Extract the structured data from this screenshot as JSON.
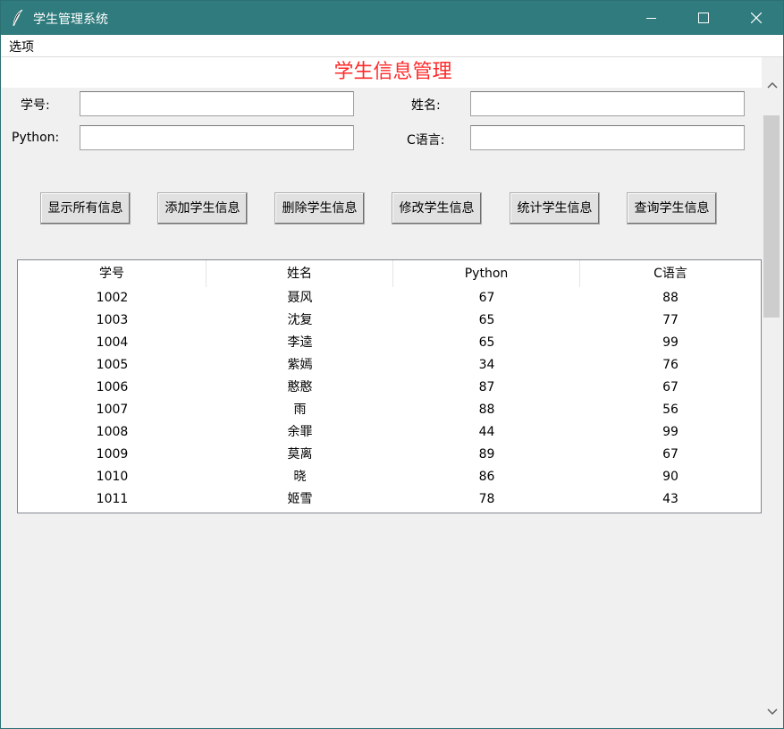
{
  "window": {
    "title": "学生管理系统"
  },
  "menubar": {
    "options_label": "选项"
  },
  "header": {
    "title": "学生信息管理"
  },
  "form": {
    "student_id_label": "学号:",
    "student_id_value": "",
    "name_label": "姓名:",
    "name_value": "",
    "python_label": "Python:",
    "python_value": "",
    "c_label": "C语言:",
    "c_value": ""
  },
  "buttons": {
    "show_all": "显示所有信息",
    "add": "添加学生信息",
    "delete": "删除学生信息",
    "modify": "修改学生信息",
    "stats": "统计学生信息",
    "query": "查询学生信息"
  },
  "table": {
    "columns": [
      "学号",
      "姓名",
      "Python",
      "C语言"
    ],
    "rows": [
      [
        "1002",
        "聂风",
        "67",
        "88"
      ],
      [
        "1003",
        "沈复",
        "65",
        "77"
      ],
      [
        "1004",
        "李逵",
        "65",
        "99"
      ],
      [
        "1005",
        "紫嫣",
        "34",
        "76"
      ],
      [
        "1006",
        "憨憨",
        "87",
        "67"
      ],
      [
        "1007",
        "雨",
        "88",
        "56"
      ],
      [
        "1008",
        "余罪",
        "44",
        "99"
      ],
      [
        "1009",
        "莫离",
        "89",
        "67"
      ],
      [
        "1010",
        "晓",
        "86",
        "90"
      ],
      [
        "1011",
        "姬雪",
        "78",
        "43"
      ]
    ]
  },
  "colors": {
    "titlebar": "#2f7b7d",
    "title_text": "#ff2a2a"
  }
}
